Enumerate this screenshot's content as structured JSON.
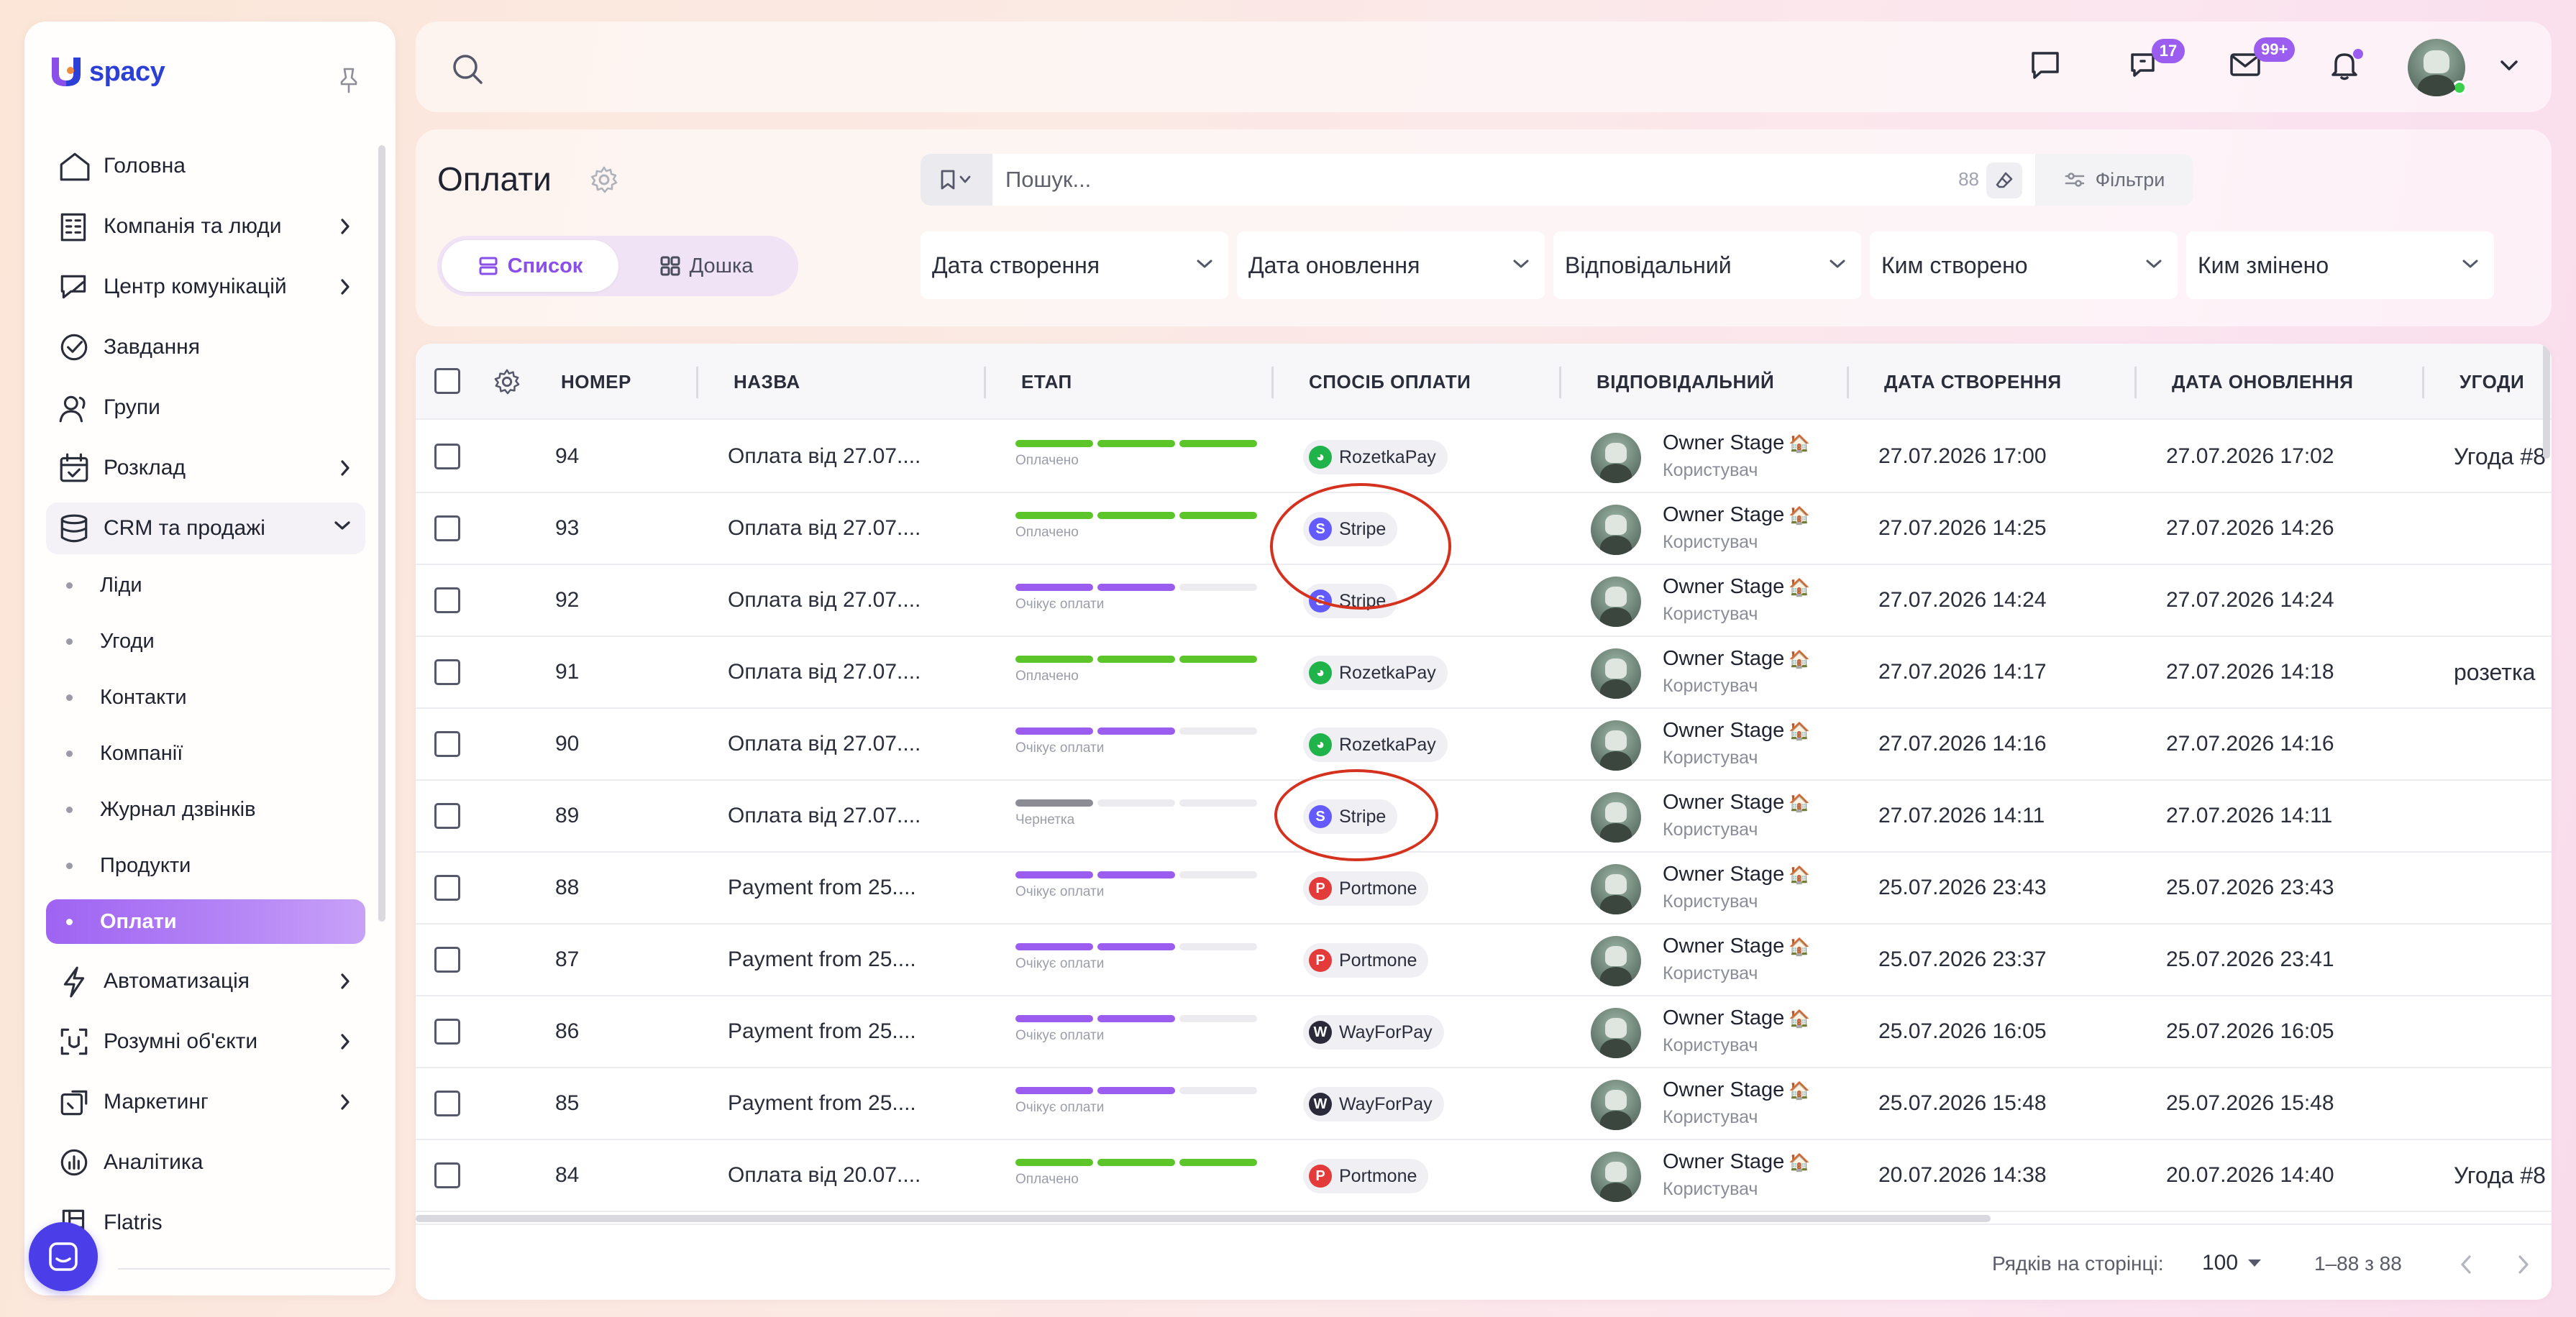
{
  "brand": {
    "name": "spacy"
  },
  "sidebar": {
    "items": [
      {
        "label": "Головна",
        "icon": "home-icon",
        "chevron": false
      },
      {
        "label": "Компанія та люди",
        "icon": "company-icon",
        "chevron": true
      },
      {
        "label": "Центр комунікацій",
        "icon": "communications-icon",
        "chevron": true
      },
      {
        "label": "Завдання",
        "icon": "tasks-icon",
        "chevron": false
      },
      {
        "label": "Групи",
        "icon": "groups-icon",
        "chevron": false
      },
      {
        "label": "Розклад",
        "icon": "calendar-icon",
        "chevron": true
      },
      {
        "label": "CRM та продажі",
        "icon": "database-icon",
        "chevron": true,
        "expanded": true
      }
    ],
    "crm_sub": [
      "Ліди",
      "Угоди",
      "Контакти",
      "Компанії",
      "Журнал дзвінків",
      "Продукти",
      "Оплати"
    ],
    "active_sub": "Оплати",
    "items_after": [
      {
        "label": "Автоматизація",
        "icon": "lightning-icon",
        "chevron": true
      },
      {
        "label": "Розумні об'єкти",
        "icon": "smart-objects-icon",
        "chevron": true
      },
      {
        "label": "Маркетинг",
        "icon": "marketing-icon",
        "chevron": true
      },
      {
        "label": "Аналітика",
        "icon": "analytics-icon",
        "chevron": false
      },
      {
        "label": "Flatris",
        "icon": "flatris-icon",
        "chevron": false
      }
    ]
  },
  "topbar": {
    "chat_badge": "17",
    "mail_badge": "99+"
  },
  "header": {
    "title": "Оплати",
    "view_list": "Список",
    "view_board": "Дошка",
    "search_placeholder": "Пошук...",
    "search_count": "88",
    "filters_label": "Фільтри",
    "filter_selects": [
      "Дата створення",
      "Дата оновлення",
      "Відповідальний",
      "Ким створено",
      "Ким змінено"
    ]
  },
  "table": {
    "columns": [
      "НОМЕР",
      "НАЗВА",
      "ЕТАП",
      "СПОСІБ ОПЛАТИ",
      "ВІДПОВІДАЛЬНИЙ",
      "ДАТА СТВОРЕННЯ",
      "ДАТА ОНОВЛЕННЯ",
      "УГОДИ"
    ],
    "stage_labels": {
      "paid": "Оплачено",
      "pending": "Очікує оплати",
      "draft": "Чернетка"
    },
    "payment_colors": {
      "RozetkaPay": "#1fb34a",
      "Stripe": "#635bff",
      "Portmone": "#e33a3a",
      "WayForPay": "#2a2a3a"
    },
    "stage_colors": {
      "paid": "#5cc52a",
      "pending": "#9b5cf0",
      "draft": "#8c8c94",
      "empty": "#ececf0"
    },
    "rows": [
      {
        "num": "94",
        "name": "Оплата від 27.07....",
        "stage": "paid",
        "pay": "RozetkaPay",
        "user": "Owner Stage",
        "role": "Користувач",
        "created": "27.07.2026 17:00",
        "updated": "27.07.2026 17:02",
        "deal": "Угода #8"
      },
      {
        "num": "93",
        "name": "Оплата від 27.07....",
        "stage": "paid",
        "pay": "Stripe",
        "user": "Owner Stage",
        "role": "Користувач",
        "created": "27.07.2026 14:25",
        "updated": "27.07.2026 14:26",
        "deal": ""
      },
      {
        "num": "92",
        "name": "Оплата від 27.07....",
        "stage": "pending",
        "pay": "Stripe",
        "user": "Owner Stage",
        "role": "Користувач",
        "created": "27.07.2026 14:24",
        "updated": "27.07.2026 14:24",
        "deal": ""
      },
      {
        "num": "91",
        "name": "Оплата від 27.07....",
        "stage": "paid",
        "pay": "RozetkaPay",
        "user": "Owner Stage",
        "role": "Користувач",
        "created": "27.07.2026 14:17",
        "updated": "27.07.2026 14:18",
        "deal": "розетка"
      },
      {
        "num": "90",
        "name": "Оплата від 27.07....",
        "stage": "pending",
        "pay": "RozetkaPay",
        "user": "Owner Stage",
        "role": "Користувач",
        "created": "27.07.2026 14:16",
        "updated": "27.07.2026 14:16",
        "deal": ""
      },
      {
        "num": "89",
        "name": "Оплата від 27.07....",
        "stage": "draft",
        "pay": "Stripe",
        "user": "Owner Stage",
        "role": "Користувач",
        "created": "27.07.2026 14:11",
        "updated": "27.07.2026 14:11",
        "deal": ""
      },
      {
        "num": "88",
        "name": "Payment from 25....",
        "stage": "pending",
        "pay": "Portmone",
        "user": "Owner Stage",
        "role": "Користувач",
        "created": "25.07.2026 23:43",
        "updated": "25.07.2026 23:43",
        "deal": ""
      },
      {
        "num": "87",
        "name": "Payment from 25....",
        "stage": "pending",
        "pay": "Portmone",
        "user": "Owner Stage",
        "role": "Користувач",
        "created": "25.07.2026 23:37",
        "updated": "25.07.2026 23:41",
        "deal": ""
      },
      {
        "num": "86",
        "name": "Payment from 25....",
        "stage": "pending",
        "pay": "WayForPay",
        "user": "Owner Stage",
        "role": "Користувач",
        "created": "25.07.2026 16:05",
        "updated": "25.07.2026 16:05",
        "deal": ""
      },
      {
        "num": "85",
        "name": "Payment from 25....",
        "stage": "pending",
        "pay": "WayForPay",
        "user": "Owner Stage",
        "role": "Користувач",
        "created": "25.07.2026 15:48",
        "updated": "25.07.2026 15:48",
        "deal": ""
      },
      {
        "num": "84",
        "name": "Оплата від 20.07....",
        "stage": "paid",
        "pay": "Portmone",
        "user": "Owner Stage",
        "role": "Користувач",
        "created": "20.07.2026 14:38",
        "updated": "20.07.2026 14:40",
        "deal": "Угода #8"
      }
    ]
  },
  "footer": {
    "rows_per_page_label": "Рядків на сторінці:",
    "rows_per_page": "100",
    "range": "1–88 з 88"
  }
}
